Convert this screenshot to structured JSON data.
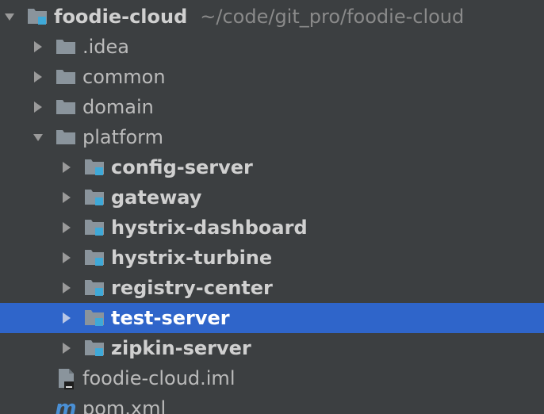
{
  "project": {
    "root": {
      "label": "foodie-cloud",
      "path": "~/code/git_pro/foodie-cloud"
    },
    "items": [
      {
        "label": ".idea",
        "expanded": false,
        "icon": "folder-icon"
      },
      {
        "label": "common",
        "expanded": false,
        "icon": "folder-icon"
      },
      {
        "label": "domain",
        "expanded": false,
        "icon": "folder-icon"
      },
      {
        "label": "platform",
        "expanded": true,
        "icon": "folder-icon"
      }
    ],
    "modules": [
      {
        "label": "config-server",
        "icon": "module-folder-icon"
      },
      {
        "label": "gateway",
        "icon": "module-folder-icon"
      },
      {
        "label": "hystrix-dashboard",
        "icon": "module-folder-icon"
      },
      {
        "label": "hystrix-turbine",
        "icon": "module-folder-icon"
      },
      {
        "label": "registry-center",
        "icon": "module-folder-icon"
      },
      {
        "label": "test-server",
        "icon": "module-folder-icon",
        "selected": true
      },
      {
        "label": "zipkin-server",
        "icon": "module-folder-icon"
      }
    ],
    "files": [
      {
        "label": "foodie-cloud.iml",
        "icon": "iml-file-icon"
      },
      {
        "label": "pom.xml",
        "icon": "maven-icon",
        "icon_glyph": "m"
      }
    ]
  },
  "colors": {
    "background": "#3c3f41",
    "selection": "#2f65ca",
    "text": "#bbbbbb",
    "folder": "#8a949c",
    "module_badge": "#3fa9d8"
  }
}
